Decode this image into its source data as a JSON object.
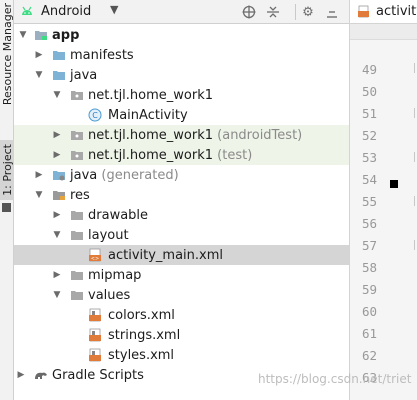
{
  "side_tabs": {
    "resource_manager": "Resource Manager",
    "project": "1: Project"
  },
  "toolbar": {
    "title": "Android",
    "icons": [
      "globe-icon",
      "collapse-all-icon",
      "settings-icon",
      "hide-icon"
    ]
  },
  "tree": [
    {
      "label": "app",
      "bold": true
    },
    {
      "label": "manifests"
    },
    {
      "label": "java"
    },
    {
      "label": "net.tjl.home_work1"
    },
    {
      "label": "MainActivity"
    },
    {
      "label": "net.tjl.home_work1",
      "suffix": "(androidTest)"
    },
    {
      "label": "net.tjl.home_work1",
      "suffix": "(test)"
    },
    {
      "label": "java",
      "suffix": "(generated)"
    },
    {
      "label": "res"
    },
    {
      "label": "drawable"
    },
    {
      "label": "layout"
    },
    {
      "label": "activity_main.xml"
    },
    {
      "label": "mipmap"
    },
    {
      "label": "values"
    },
    {
      "label": "colors.xml"
    },
    {
      "label": "strings.xml"
    },
    {
      "label": "styles.xml"
    },
    {
      "label": "Gradle Scripts"
    }
  ],
  "editor": {
    "tab_label": "activity_",
    "line_numbers": [
      "49",
      "50",
      "51",
      "52",
      "53",
      "54",
      "55",
      "56",
      "57",
      "58",
      "59",
      "60",
      "61",
      "62",
      "63"
    ]
  },
  "watermark": "https://blog.csdn.net/triet",
  "colors": {
    "selection": "#d5d5d5",
    "test_bg": "#eef5e8",
    "folder": "#8fa3b3",
    "android_green": "#3ddc84"
  }
}
